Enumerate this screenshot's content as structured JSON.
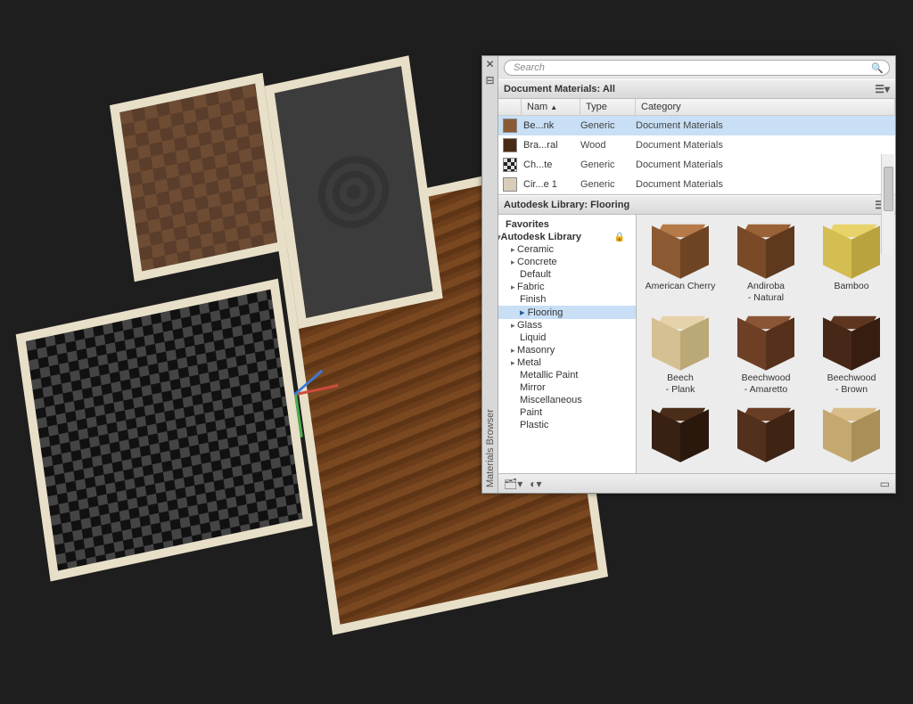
{
  "panel": {
    "title_vertical": "Materials Browser",
    "search_placeholder": "Search"
  },
  "doc_section": {
    "header": "Document Materials: All",
    "columns": {
      "name": "Nam",
      "type": "Type",
      "category": "Category"
    }
  },
  "doc_rows": [
    {
      "name": "Be...nk",
      "type": "Generic",
      "category": "Document Materials",
      "swatch": "#8a5a35",
      "selected": true
    },
    {
      "name": "Bra...ral",
      "type": "Wood",
      "category": "Document Materials",
      "swatch": "#4a2a15",
      "selected": false
    },
    {
      "name": "Ch...te",
      "type": "Generic",
      "category": "Document Materials",
      "swatch": "repeating-conic-gradient(#222 0 25%, #ddd 0 50%)",
      "selected": false
    },
    {
      "name": "Cir...e 1",
      "type": "Generic",
      "category": "Document Materials",
      "swatch": "#d8cdb8",
      "selected": false
    }
  ],
  "lib_section": {
    "header": "Autodesk Library: Flooring"
  },
  "tree": {
    "favorites": "Favorites",
    "root": "Autodesk Library",
    "items": [
      {
        "label": "Ceramic",
        "expandable": true
      },
      {
        "label": "Concrete",
        "expandable": true
      },
      {
        "label": "Default",
        "expandable": false
      },
      {
        "label": "Fabric",
        "expandable": true
      },
      {
        "label": "Finish",
        "expandable": false
      },
      {
        "label": "Flooring",
        "expandable": true,
        "selected": true
      },
      {
        "label": "Glass",
        "expandable": true
      },
      {
        "label": "Liquid",
        "expandable": false
      },
      {
        "label": "Masonry",
        "expandable": true
      },
      {
        "label": "Metal",
        "expandable": true
      },
      {
        "label": "Metallic Paint",
        "expandable": false
      },
      {
        "label": "Mirror",
        "expandable": false
      },
      {
        "label": "Miscellaneous",
        "expandable": false
      },
      {
        "label": "Paint",
        "expandable": false
      },
      {
        "label": "Plastic",
        "expandable": false
      }
    ]
  },
  "thumbs": [
    {
      "label": "American Cherry",
      "top": "#b57a48",
      "left": "#8c5a32",
      "right": "#6e4524"
    },
    {
      "label": "Andiroba - Natural",
      "top": "#9a6236",
      "left": "#7a4a28",
      "right": "#5f391e"
    },
    {
      "label": "Bamboo",
      "top": "#e8d36a",
      "left": "#d4be52",
      "right": "#b8a33e"
    },
    {
      "label": "Beech - Plank",
      "top": "#e6d3aa",
      "left": "#d4c092",
      "right": "#bba877"
    },
    {
      "label": "Beechwood - Amaretto",
      "top": "#8a5534",
      "left": "#6d4026",
      "right": "#55311c"
    },
    {
      "label": "Beechwood - Brown",
      "top": "#5e3620",
      "left": "#472717",
      "right": "#361d10"
    },
    {
      "label": "",
      "top": "#4a2e1a",
      "left": "#382112",
      "right": "#2a180c"
    },
    {
      "label": "",
      "top": "#6a3d25",
      "left": "#52301c",
      "right": "#3f2414"
    },
    {
      "label": "",
      "top": "#d8bd8a",
      "left": "#c4a870",
      "right": "#aa8f58"
    }
  ]
}
